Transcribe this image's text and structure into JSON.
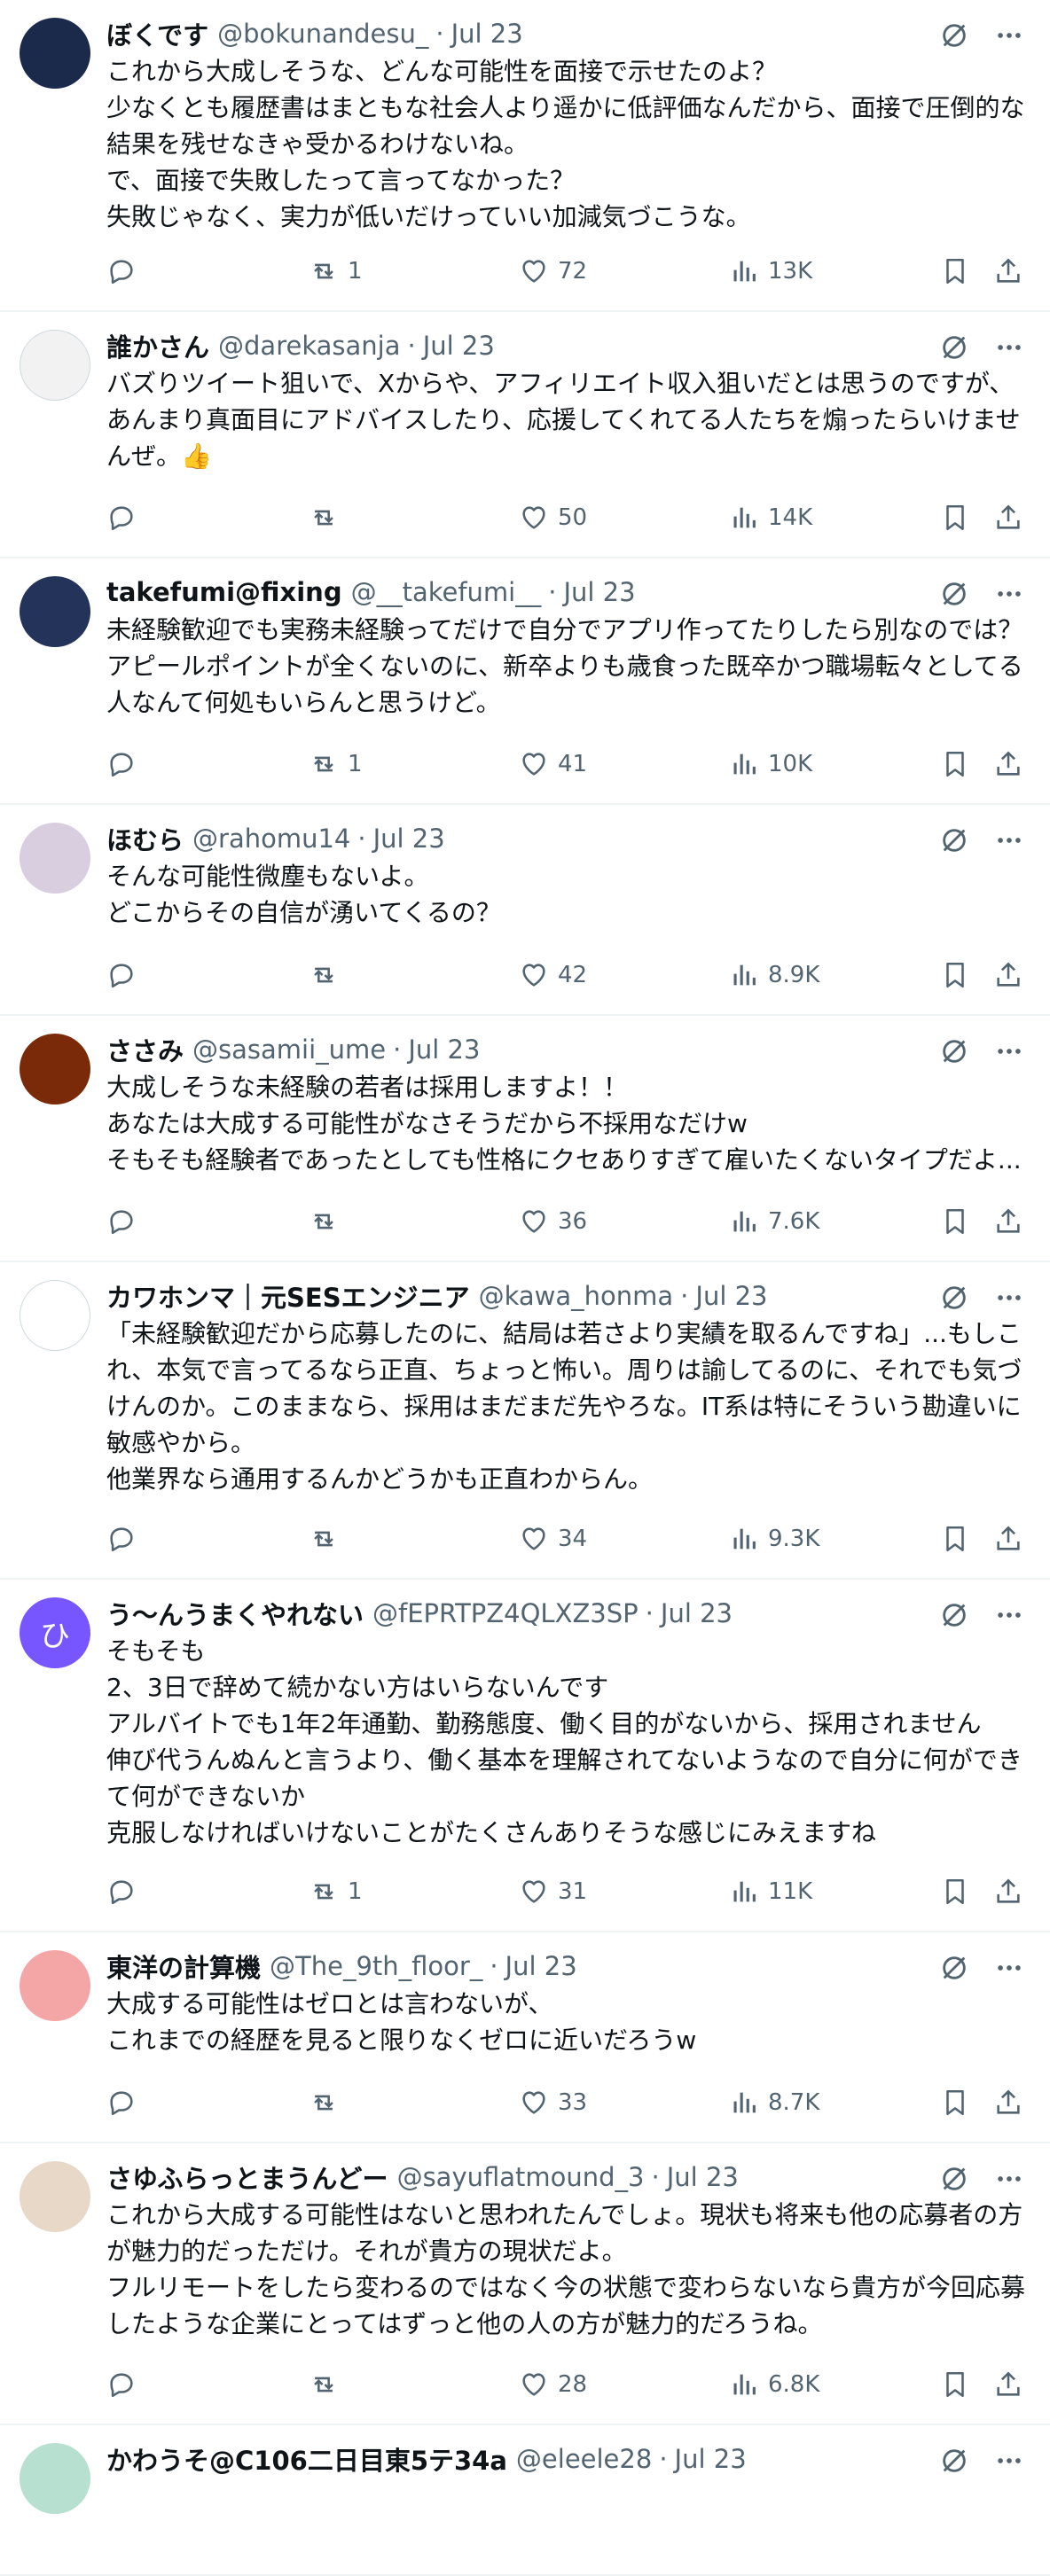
{
  "tweets": [
    {
      "name": "ぼくです",
      "handle": "@bokunandesu_",
      "date": "Jul 23",
      "avatar_color": "#1b2a4a",
      "lines": [
        "これから大成しそうな、どんな可能性を面接で示せたのよ？",
        "少なくとも履歴書はまともな社会人より遥かに低評価なんだから、面接で圧倒的な",
        "結果を残せなきゃ受かるわけないね。",
        "で、面接で失敗したって言ってなかった？",
        "失敗じゃなく、実力が低いだけっていい加減気づこうな。"
      ],
      "retweets": "1",
      "likes": "72",
      "views": "13K"
    },
    {
      "name": "誰かさん",
      "handle": "@darekasanja",
      "date": "Jul 23",
      "avatar_color": "#f2f2f2",
      "lines": [
        "バズりツイート狙いで、Xからや、アフィリエイト収入狙いだとは思うのですが、",
        "あんまり真面目にアドバイスしたり、応援してくれてる人たちを煽ったらいけませ",
        "んぜ。👍"
      ],
      "retweets": "",
      "likes": "50",
      "views": "14K"
    },
    {
      "name": "takefumi@fixing",
      "handle": "@__takefumi__",
      "date": "Jul 23",
      "avatar_color": "#23335a",
      "lines": [
        "未経験歓迎でも実務未経験ってだけで自分でアプリ作ってたりしたら別なのでは？",
        "アピールポイントが全くないのに、新卒よりも歳食った既卒かつ職場転々としてる",
        "人なんて何処もいらんと思うけど。"
      ],
      "retweets": "1",
      "likes": "41",
      "views": "10K"
    },
    {
      "name": "ほむら",
      "handle": "@rahomu14",
      "date": "Jul 23",
      "avatar_color": "#d9cde0",
      "lines": [
        "そんな可能性微塵もないよ。",
        "どこからその自信が湧いてくるの？"
      ],
      "retweets": "",
      "likes": "42",
      "views": "8.9K"
    },
    {
      "name": "ささみ",
      "handle": "@sasamii_ume",
      "date": "Jul 23",
      "avatar_color": "#7a2a08",
      "lines": [
        "大成しそうな未経験の若者は採用しますよ！！",
        "あなたは大成する可能性がなさそうだから不採用なだけw",
        "そもそも経験者であったとしても性格にクセありすぎて雇いたくないタイプだよ..."
      ],
      "retweets": "",
      "likes": "36",
      "views": "7.6K"
    },
    {
      "name": "カワホンマ｜元SESエンジニア",
      "handle": "@kawa_honma",
      "date": "Jul 23",
      "avatar_color": "#ffffff",
      "lines": [
        "「未経験歓迎だから応募したのに、結局は若さより実績を取るんですね」...もしこ",
        "れ、本気で言ってるなら正直、ちょっと怖い。周りは諭してるのに、それでも気づ",
        "けんのか。このままなら、採用はまだまだ先やろな。IT系は特にそういう勘違いに",
        "敏感やから。",
        "他業界なら通用するんかどうかも正直わからん。"
      ],
      "retweets": "",
      "likes": "34",
      "views": "9.3K"
    },
    {
      "name": "う〜んうまくやれない",
      "handle": "@fEPRTPZ4QLXZ3SP",
      "date": "Jul 23",
      "avatar_color": "#7856ff",
      "avatar_initial": "ひ",
      "lines": [
        "そもそも",
        "2、3日で辞めて続かない方はいらないんです",
        "アルバイトでも1年2年通勤、勤務態度、働く目的がないから、採用されません",
        "伸び代うんぬんと言うより、働く基本を理解されてないようなので自分に何ができ",
        "て何ができないか",
        "克服しなければいけないことがたくさんありそうな感じにみえますね"
      ],
      "retweets": "1",
      "likes": "31",
      "views": "11K"
    },
    {
      "name": "東洋の計算機",
      "handle": "@The_9th_floor_",
      "date": "Jul 23",
      "avatar_color": "#f4a6a6",
      "lines": [
        "大成する可能性はゼロとは言わないが、",
        "これまでの経歴を見ると限りなくゼロに近いだろうw"
      ],
      "retweets": "",
      "likes": "33",
      "views": "8.7K"
    },
    {
      "name": "さゆふらっとまうんどー",
      "handle": "@sayuflatmound_3",
      "date": "Jul 23",
      "avatar_color": "#e8d8c8",
      "lines": [
        "これから大成する可能性はないと思われたんでしょ。現状も将来も他の応募者の方",
        "が魅力的だっただけ。それが貴方の現状だよ。",
        "フルリモートをしたら変わるのではなく今の状態で変わらないなら貴方が今回応募",
        "したような企業にとってはずっと他の人の方が魅力的だろうね。"
      ],
      "retweets": "",
      "likes": "28",
      "views": "6.8K"
    },
    {
      "name": "かわうそ@C106二日目東5テ34a",
      "handle": "@eleele28",
      "date": "Jul 23",
      "avatar_color": "#b8e0d0",
      "lines": []
    }
  ]
}
